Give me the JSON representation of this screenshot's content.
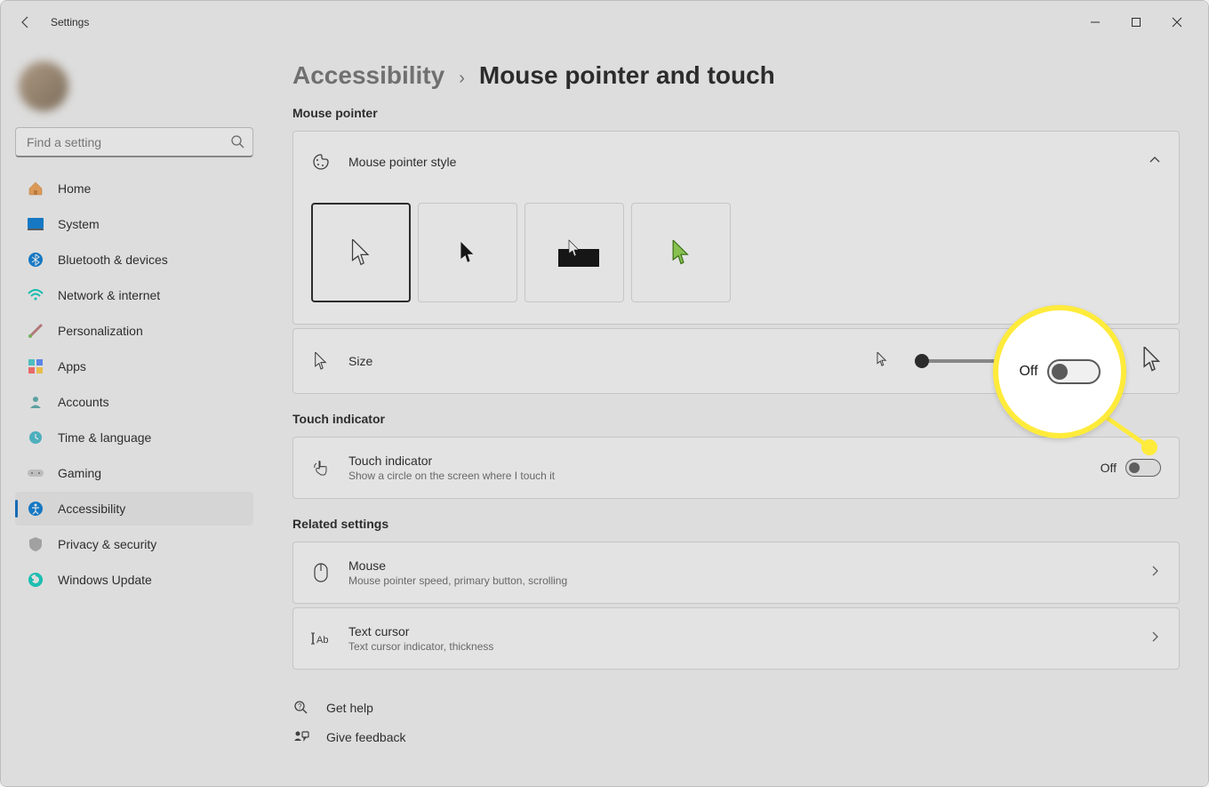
{
  "window": {
    "title": "Settings"
  },
  "user": {
    "name": " ",
    "email": " "
  },
  "search": {
    "placeholder": "Find a setting"
  },
  "nav": {
    "items": [
      {
        "label": "Home"
      },
      {
        "label": "System"
      },
      {
        "label": "Bluetooth & devices"
      },
      {
        "label": "Network & internet"
      },
      {
        "label": "Personalization"
      },
      {
        "label": "Apps"
      },
      {
        "label": "Accounts"
      },
      {
        "label": "Time & language"
      },
      {
        "label": "Gaming"
      },
      {
        "label": "Accessibility"
      },
      {
        "label": "Privacy & security"
      },
      {
        "label": "Windows Update"
      }
    ],
    "active_index": 9
  },
  "breadcrumb": {
    "parent": "Accessibility",
    "current": "Mouse pointer and touch"
  },
  "sections": {
    "mouse_pointer_label": "Mouse pointer",
    "style_title": "Mouse pointer style",
    "size_title": "Size",
    "touch_label": "Touch indicator",
    "touch_title": "Touch indicator",
    "touch_sub": "Show a circle on the screen where I touch it",
    "touch_state": "Off",
    "related_label": "Related settings",
    "mouse_title": "Mouse",
    "mouse_sub": "Mouse pointer speed, primary button, scrolling",
    "text_cursor_title": "Text cursor",
    "text_cursor_sub": "Text cursor indicator, thickness",
    "get_help": "Get help",
    "feedback": "Give feedback"
  },
  "callout": {
    "label": "Off"
  }
}
